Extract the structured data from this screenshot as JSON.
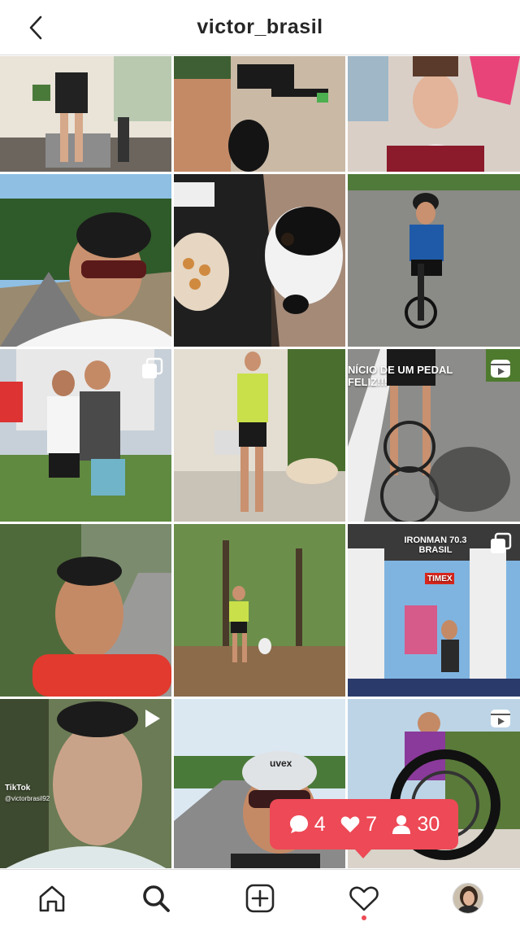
{
  "header": {
    "title": "victor_brasil",
    "back_icon": "chevron-left-icon"
  },
  "posts": [
    {
      "id": "post-1",
      "type": "photo"
    },
    {
      "id": "post-2",
      "type": "photo"
    },
    {
      "id": "post-3",
      "type": "photo"
    },
    {
      "id": "post-4",
      "type": "photo"
    },
    {
      "id": "post-5",
      "type": "photo"
    },
    {
      "id": "post-6",
      "type": "photo"
    },
    {
      "id": "post-7",
      "type": "carousel"
    },
    {
      "id": "post-8",
      "type": "photo"
    },
    {
      "id": "post-9",
      "type": "reel",
      "caption": "NÍCIO DE UM PEDAL\nFELIZ!!!"
    },
    {
      "id": "post-10",
      "type": "photo"
    },
    {
      "id": "post-11",
      "type": "photo"
    },
    {
      "id": "post-12",
      "type": "carousel",
      "banner": "IRONMAN 70.3 BRASIL",
      "sponsor": "TIMEX"
    },
    {
      "id": "post-13",
      "type": "video",
      "tiktok_label": "TikTok",
      "tiktok_user": "@victorbrasil92"
    },
    {
      "id": "post-14",
      "type": "photo",
      "helmet_brand": "uvex"
    },
    {
      "id": "post-15",
      "type": "reel"
    }
  ],
  "activity": {
    "comments": "4",
    "likes": "7",
    "followers": "30",
    "color": "#ed4956"
  },
  "nav": {
    "items": [
      "home-icon",
      "search-icon",
      "new-post-icon",
      "activity-heart-icon",
      "profile-avatar"
    ],
    "active": "search"
  }
}
